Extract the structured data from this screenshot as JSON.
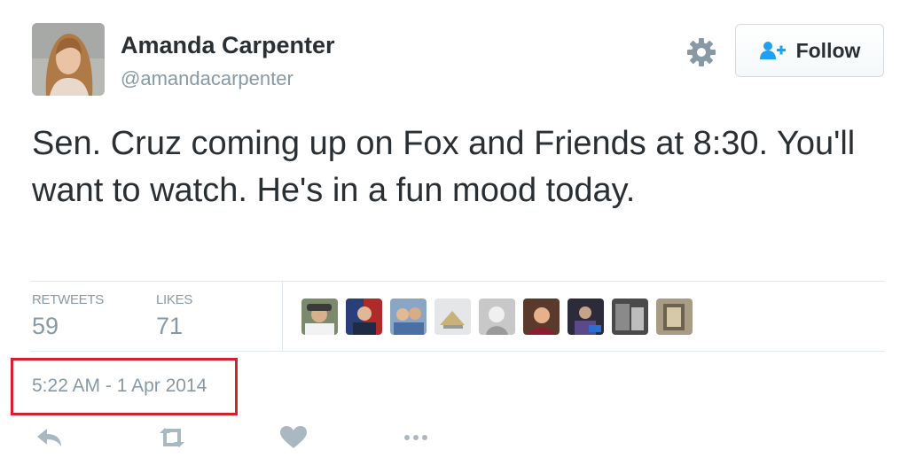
{
  "user": {
    "name": "Amanda Carpenter",
    "handle": "@amandacarpenter"
  },
  "follow_button": {
    "label": "Follow"
  },
  "tweet": {
    "text": "Sen. Cruz coming up on Fox and Friends at 8:30. You'll want to watch. He's in a fun mood today.",
    "timestamp": "5:22 AM - 1 Apr 2014"
  },
  "stats": {
    "retweets_label": "RETWEETS",
    "retweets_count": "59",
    "likes_label": "LIKES",
    "likes_count": "71"
  },
  "colors": {
    "text": "#292f33",
    "muted": "#8899a6",
    "highlight_box": "#d6202b",
    "follow_icon": "#1da1f2"
  },
  "icons": [
    "gear-icon",
    "follow-user-icon",
    "reply-icon",
    "retweet-icon",
    "like-icon",
    "more-icon"
  ]
}
